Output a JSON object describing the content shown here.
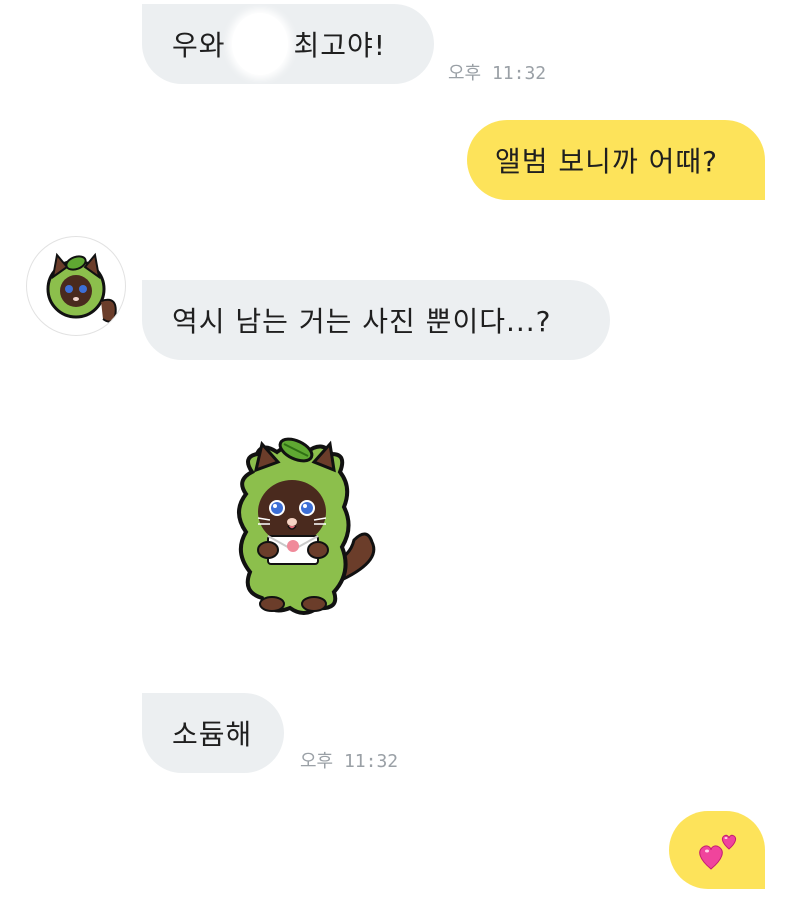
{
  "messages": [
    {
      "side": "in",
      "text_before": "우와",
      "text_after": "최고야!",
      "time": "오후 11:32"
    },
    {
      "side": "out",
      "text": "앨범 보니까 어때?"
    },
    {
      "side": "in",
      "text": "역시 남는 거는 사진 뿐이다...?"
    },
    {
      "side": "in",
      "type": "sticker",
      "sticker": "leaf-cat-sticker"
    },
    {
      "side": "in",
      "text": "소듐해",
      "time": "오후 11:32"
    },
    {
      "side": "out",
      "type": "emoji",
      "emoji": "two-hearts-emoji"
    }
  ],
  "colors": {
    "incoming_bubble": "#eceff1",
    "outgoing_bubble": "#fde35a",
    "timestamp": "#9aa0a6",
    "background": "#ffffff"
  },
  "icons": {
    "avatar": "leaf-cat-avatar",
    "sticker": "leaf-cat-sticker",
    "emoji": "two-hearts-emoji"
  }
}
